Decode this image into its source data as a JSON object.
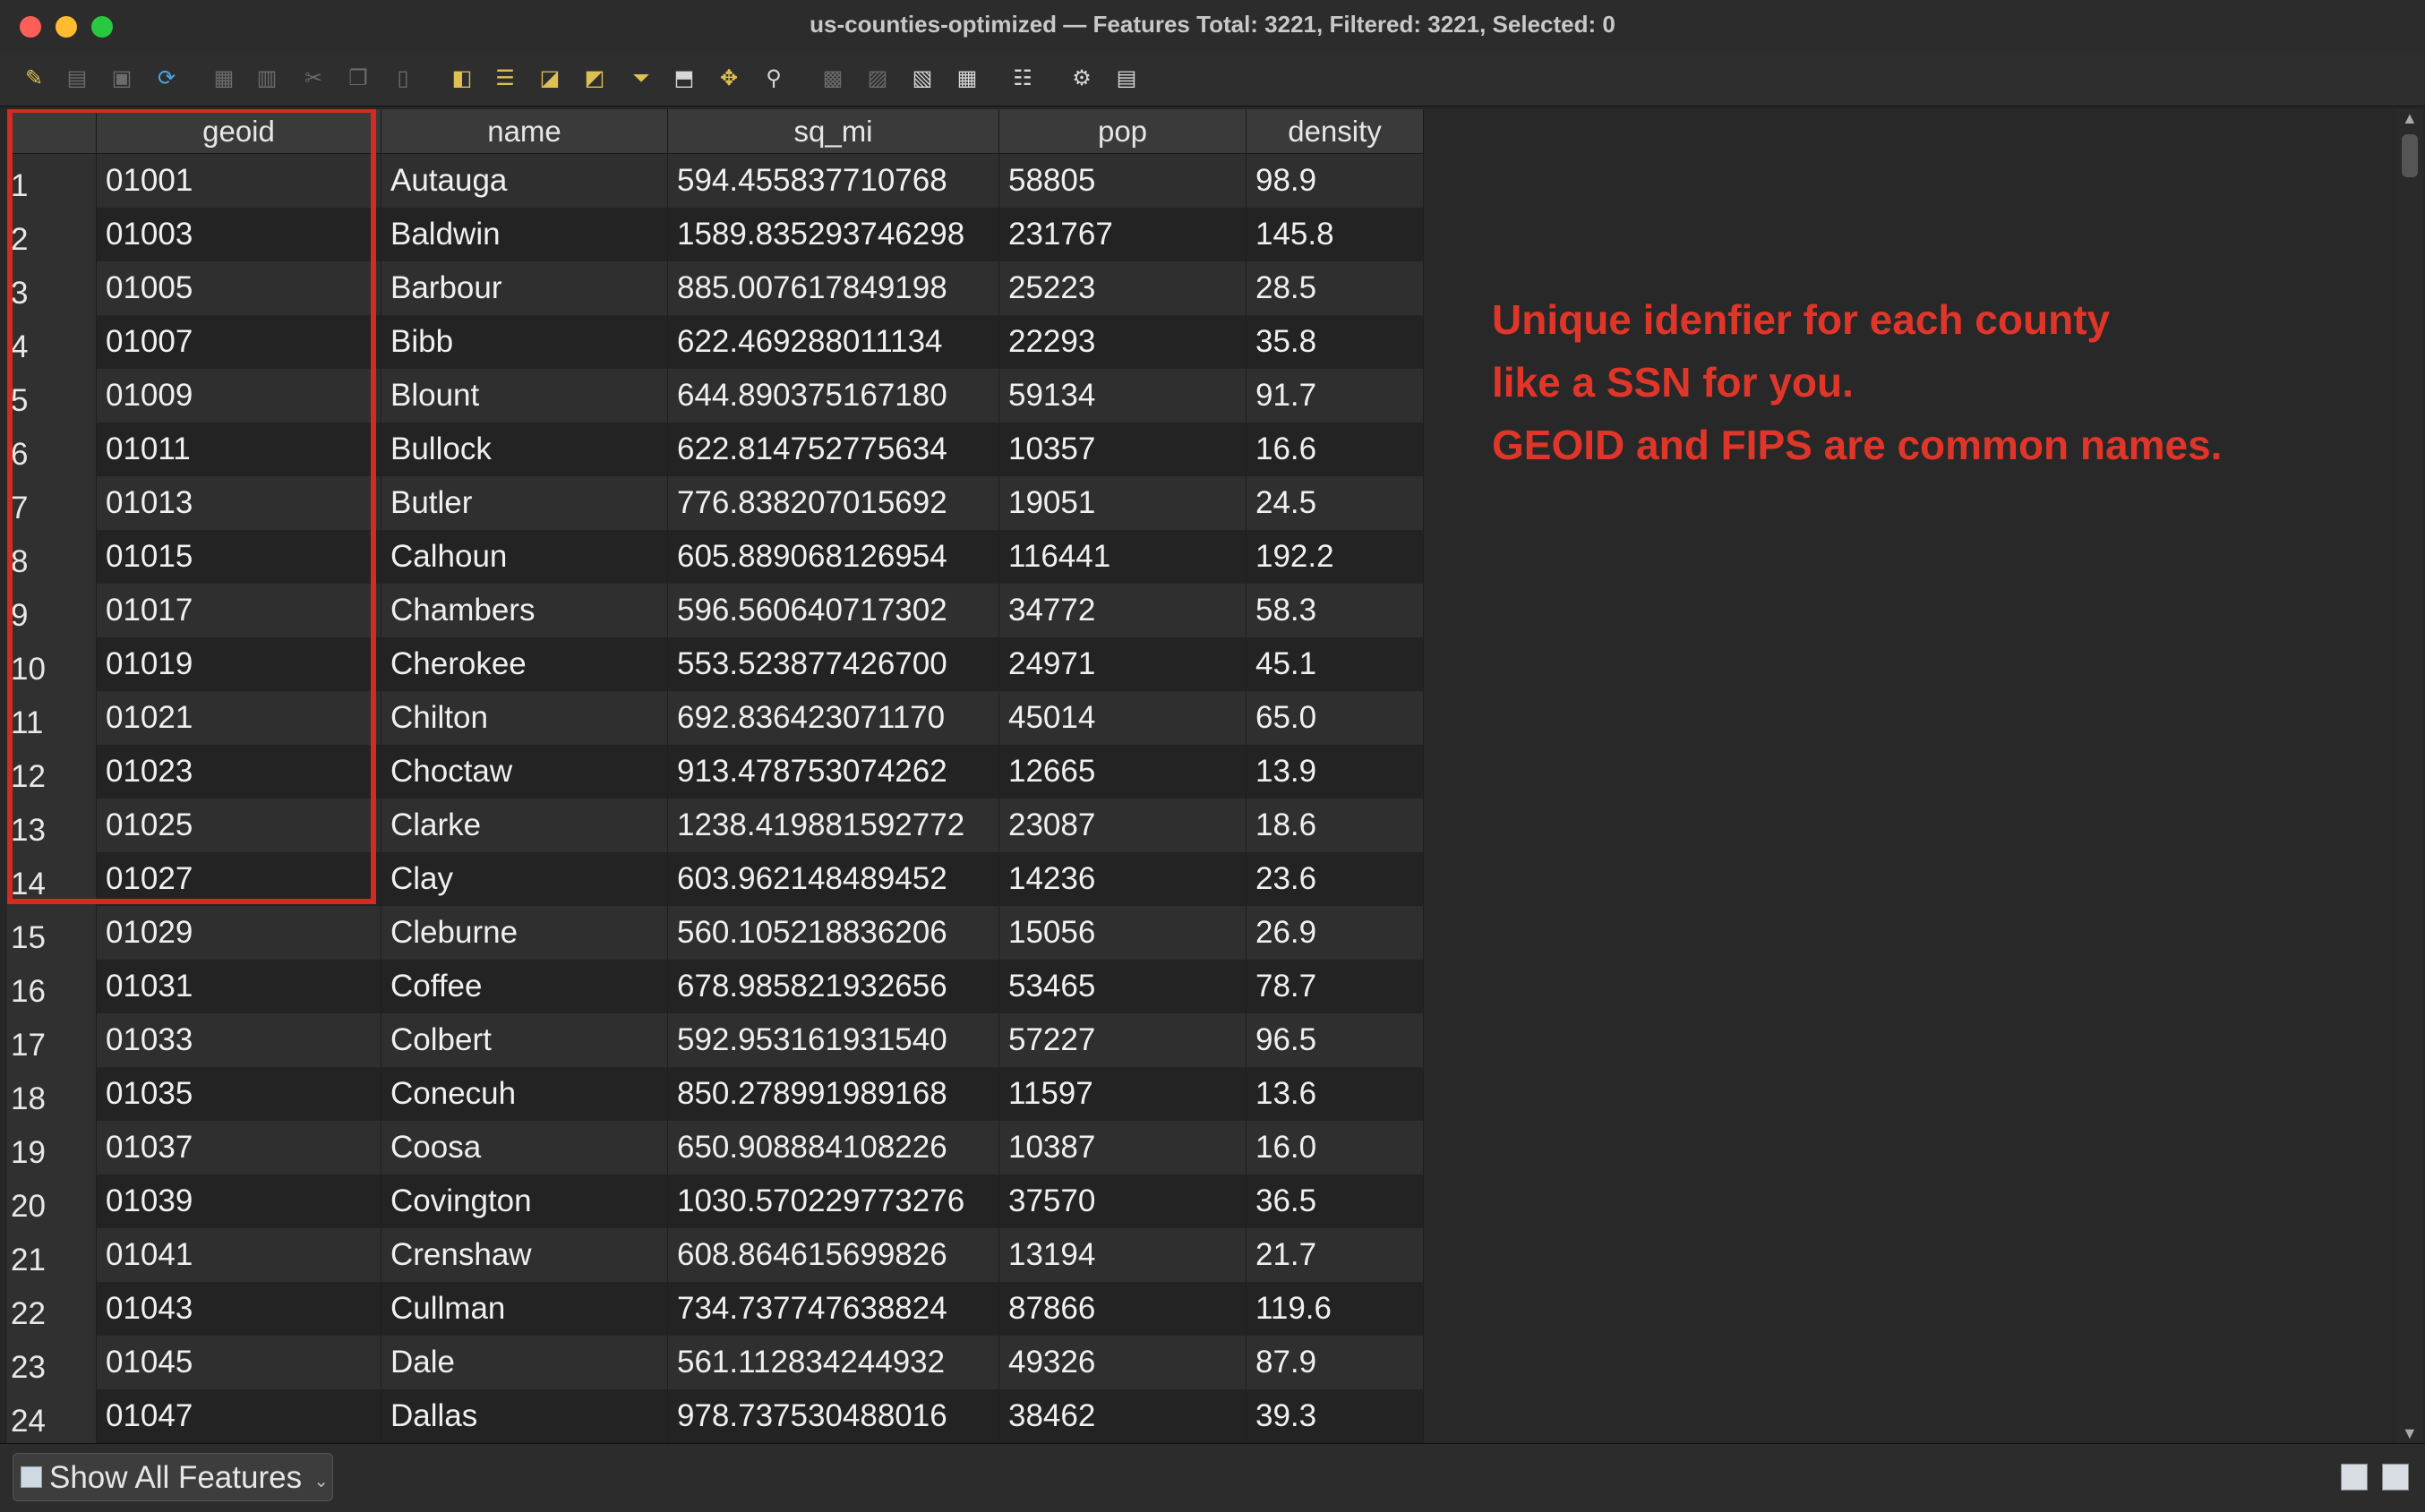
{
  "window": {
    "title": "us-counties-optimized — Features Total: 3221, Filtered: 3221, Selected: 0"
  },
  "toolbar": {
    "icons": [
      "pencil-icon",
      "multi-edit-icon",
      "save-edits-icon",
      "reload-icon",
      "add-feature-icon",
      "delete-feature-icon",
      "cut-icon",
      "copy-icon",
      "paste-icon",
      "select-expression-icon",
      "select-all-icon",
      "invert-selection-icon",
      "deselect-all-icon",
      "filter-select-icon",
      "move-selection-top-icon",
      "pan-to-selected-icon",
      "zoom-to-selected-icon",
      "new-field-icon",
      "delete-field-icon",
      "field-calculator-icon",
      "conditional-format-icon",
      "dock-icon",
      "actions-icon",
      "duplicate-icon"
    ]
  },
  "table": {
    "columns": [
      "geoid",
      "name",
      "sq_mi",
      "pop",
      "density"
    ],
    "rows": [
      [
        "1",
        "01001",
        "Autauga",
        "594.455837710768",
        "58805",
        "98.9"
      ],
      [
        "2",
        "01003",
        "Baldwin",
        "1589.835293746298",
        "231767",
        "145.8"
      ],
      [
        "3",
        "01005",
        "Barbour",
        "885.007617849198",
        "25223",
        "28.5"
      ],
      [
        "4",
        "01007",
        "Bibb",
        "622.469288011134",
        "22293",
        "35.8"
      ],
      [
        "5",
        "01009",
        "Blount",
        "644.890375167180",
        "59134",
        "91.7"
      ],
      [
        "6",
        "01011",
        "Bullock",
        "622.814752775634",
        "10357",
        "16.6"
      ],
      [
        "7",
        "01013",
        "Butler",
        "776.838207015692",
        "19051",
        "24.5"
      ],
      [
        "8",
        "01015",
        "Calhoun",
        "605.889068126954",
        "116441",
        "192.2"
      ],
      [
        "9",
        "01017",
        "Chambers",
        "596.560640717302",
        "34772",
        "58.3"
      ],
      [
        "10",
        "01019",
        "Cherokee",
        "553.523877426700",
        "24971",
        "45.1"
      ],
      [
        "11",
        "01021",
        "Chilton",
        "692.836423071170",
        "45014",
        "65.0"
      ],
      [
        "12",
        "01023",
        "Choctaw",
        "913.478753074262",
        "12665",
        "13.9"
      ],
      [
        "13",
        "01025",
        "Clarke",
        "1238.419881592772",
        "23087",
        "18.6"
      ],
      [
        "14",
        "01027",
        "Clay",
        "603.962148489452",
        "14236",
        "23.6"
      ],
      [
        "15",
        "01029",
        "Cleburne",
        "560.105218836206",
        "15056",
        "26.9"
      ],
      [
        "16",
        "01031",
        "Coffee",
        "678.985821932656",
        "53465",
        "78.7"
      ],
      [
        "17",
        "01033",
        "Colbert",
        "592.953161931540",
        "57227",
        "96.5"
      ],
      [
        "18",
        "01035",
        "Conecuh",
        "850.278991989168",
        "11597",
        "13.6"
      ],
      [
        "19",
        "01037",
        "Coosa",
        "650.908884108226",
        "10387",
        "16.0"
      ],
      [
        "20",
        "01039",
        "Covington",
        "1030.570229773276",
        "37570",
        "36.5"
      ],
      [
        "21",
        "01041",
        "Crenshaw",
        "608.864615699826",
        "13194",
        "21.7"
      ],
      [
        "22",
        "01043",
        "Cullman",
        "734.737747638824",
        "87866",
        "119.6"
      ],
      [
        "23",
        "01045",
        "Dale",
        "561.112834244932",
        "49326",
        "87.9"
      ],
      [
        "24",
        "01047",
        "Dallas",
        "978.737530488016",
        "38462",
        "39.3"
      ]
    ]
  },
  "annotation": {
    "lines": [
      "Unique idenfier for each county",
      "like a SSN for you.",
      "GEOID and FIPS are common names."
    ],
    "color": "#e0362a"
  },
  "footer": {
    "filter_button": "Show All Features"
  },
  "colors": {
    "highlight_border": "#d42b1e"
  }
}
